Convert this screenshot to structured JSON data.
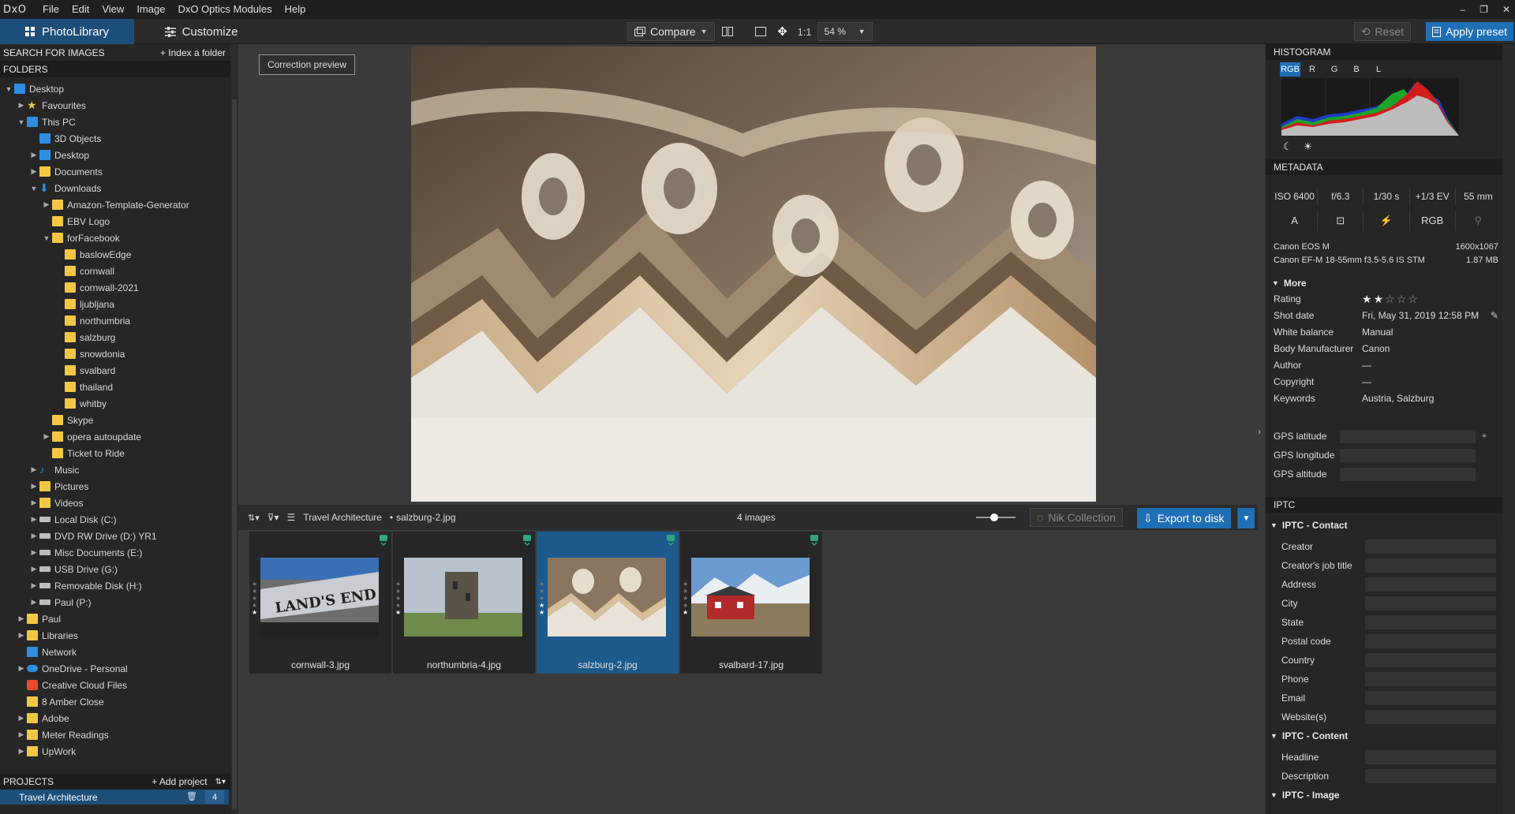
{
  "app": {
    "logo": "DxO"
  },
  "menu": [
    "File",
    "Edit",
    "View",
    "Image",
    "DxO Optics Modules",
    "Help"
  ],
  "window_controls": [
    "–",
    "❐",
    "✕"
  ],
  "toolbar": {
    "photolibrary_label": "PhotoLibrary",
    "customize_label": "Customize",
    "compare_label": "Compare",
    "ratio_label": "1:1",
    "zoom_value": "54 %",
    "reset_label": "Reset",
    "apply_preset_label": "Apply preset"
  },
  "left": {
    "search_label": "SEARCH FOR IMAGES",
    "index_label": "+ Index a folder",
    "folders_label": "FOLDERS",
    "tree": [
      {
        "label": "Desktop",
        "depth": 0,
        "arrow": "▼",
        "icon": "blue"
      },
      {
        "label": "Favourites",
        "depth": 1,
        "arrow": "▶",
        "icon": "star"
      },
      {
        "label": "This PC",
        "depth": 1,
        "arrow": "▼",
        "icon": "blue"
      },
      {
        "label": "3D Objects",
        "depth": 2,
        "arrow": "",
        "icon": "blue"
      },
      {
        "label": "Desktop",
        "depth": 2,
        "arrow": "▶",
        "icon": "blue"
      },
      {
        "label": "Documents",
        "depth": 2,
        "arrow": "▶",
        "icon": "folder"
      },
      {
        "label": "Downloads",
        "depth": 2,
        "arrow": "▼",
        "icon": "down"
      },
      {
        "label": "Amazon-Template-Generator",
        "depth": 3,
        "arrow": "▶",
        "icon": "folder"
      },
      {
        "label": "EBV Logo",
        "depth": 3,
        "arrow": "",
        "icon": "folder"
      },
      {
        "label": "forFacebook",
        "depth": 3,
        "arrow": "▼",
        "icon": "folder"
      },
      {
        "label": "baslowEdge",
        "depth": 4,
        "arrow": "",
        "icon": "folder"
      },
      {
        "label": "cornwall",
        "depth": 4,
        "arrow": "",
        "icon": "folder"
      },
      {
        "label": "cornwall-2021",
        "depth": 4,
        "arrow": "",
        "icon": "folder"
      },
      {
        "label": "ljubljana",
        "depth": 4,
        "arrow": "",
        "icon": "folder"
      },
      {
        "label": "northumbria",
        "depth": 4,
        "arrow": "",
        "icon": "folder"
      },
      {
        "label": "salzburg",
        "depth": 4,
        "arrow": "",
        "icon": "folder"
      },
      {
        "label": "snowdonia",
        "depth": 4,
        "arrow": "",
        "icon": "folder"
      },
      {
        "label": "svalbard",
        "depth": 4,
        "arrow": "",
        "icon": "folder"
      },
      {
        "label": "thailand",
        "depth": 4,
        "arrow": "",
        "icon": "folder"
      },
      {
        "label": "whitby",
        "depth": 4,
        "arrow": "",
        "icon": "folder"
      },
      {
        "label": "Skype",
        "depth": 3,
        "arrow": "",
        "icon": "folder"
      },
      {
        "label": "opera autoupdate",
        "depth": 3,
        "arrow": "▶",
        "icon": "folder"
      },
      {
        "label": "Ticket to Ride",
        "depth": 3,
        "arrow": "",
        "icon": "folder"
      },
      {
        "label": "Music",
        "depth": 2,
        "arrow": "▶",
        "icon": "music"
      },
      {
        "label": "Pictures",
        "depth": 2,
        "arrow": "▶",
        "icon": "folder"
      },
      {
        "label": "Videos",
        "depth": 2,
        "arrow": "▶",
        "icon": "folder"
      },
      {
        "label": "Local Disk (C:)",
        "depth": 2,
        "arrow": "▶",
        "icon": "drive"
      },
      {
        "label": "DVD RW Drive (D:) YR1",
        "depth": 2,
        "arrow": "▶",
        "icon": "drive"
      },
      {
        "label": "Misc Documents (E:)",
        "depth": 2,
        "arrow": "▶",
        "icon": "drive"
      },
      {
        "label": "USB Drive (G:)",
        "depth": 2,
        "arrow": "▶",
        "icon": "drive"
      },
      {
        "label": "Removable Disk (H:)",
        "depth": 2,
        "arrow": "▶",
        "icon": "drive"
      },
      {
        "label": "Paul (P:)",
        "depth": 2,
        "arrow": "▶",
        "icon": "drive"
      },
      {
        "label": "Paul",
        "depth": 1,
        "arrow": "▶",
        "icon": "folder"
      },
      {
        "label": "Libraries",
        "depth": 1,
        "arrow": "▶",
        "icon": "folder"
      },
      {
        "label": "Network",
        "depth": 1,
        "arrow": "",
        "icon": "blue"
      },
      {
        "label": "OneDrive - Personal",
        "depth": 1,
        "arrow": "▶",
        "icon": "cloud"
      },
      {
        "label": "Creative Cloud Files",
        "depth": 1,
        "arrow": "",
        "icon": "cc"
      },
      {
        "label": "8 Amber Close",
        "depth": 1,
        "arrow": "",
        "icon": "folder"
      },
      {
        "label": "Adobe",
        "depth": 1,
        "arrow": "▶",
        "icon": "folder"
      },
      {
        "label": "Meter Readings",
        "depth": 1,
        "arrow": "▶",
        "icon": "folder"
      },
      {
        "label": "UpWork",
        "depth": 1,
        "arrow": "▶",
        "icon": "folder"
      }
    ],
    "projects_label": "PROJECTS",
    "add_project_label": "+ Add project",
    "project_name": "Travel Architecture",
    "project_count": "4"
  },
  "viewer": {
    "correction_preview_label": "Correction preview"
  },
  "filmbar": {
    "project": "Travel Architecture",
    "separator": "•",
    "file": "salzburg-2.jpg",
    "count_label": "4 images",
    "nik_label": "Nik Collection",
    "export_label": "Export to disk"
  },
  "thumbnails": [
    {
      "filename": "cornwall-3.jpg",
      "selected": false
    },
    {
      "filename": "northumbria-4.jpg",
      "selected": false
    },
    {
      "filename": "salzburg-2.jpg",
      "selected": true
    },
    {
      "filename": "svalbard-17.jpg",
      "selected": false
    }
  ],
  "thumb_text": {
    "lands_end": "LAND'S END"
  },
  "right": {
    "histogram_label": "HISTOGRAM",
    "histogram_tabs": [
      "RGB",
      "R",
      "G",
      "B",
      "L"
    ],
    "metadata_label": "METADATA",
    "exif": [
      "ISO 6400",
      "f/6.3",
      "1/30 s",
      "+1/3 EV",
      "55 mm"
    ],
    "exif_icons": [
      "A",
      "⊡",
      "⚡",
      "RGB",
      "⚲"
    ],
    "camera": "Canon EOS M",
    "dimensions": "1600x1067",
    "lens": "Canon EF-M 18-55mm f3.5-5.6 IS STM",
    "filesize": "1.87 MB",
    "more_label": "More",
    "rating": 2,
    "fields": [
      {
        "k": "Rating",
        "v": ""
      },
      {
        "k": "Shot date",
        "v": "Fri, May 31, 2019 12:58 PM"
      },
      {
        "k": "White balance",
        "v": "Manual"
      },
      {
        "k": "Body Manufacturer",
        "v": "Canon"
      },
      {
        "k": "Author",
        "v": "—"
      },
      {
        "k": "Copyright",
        "v": "—"
      },
      {
        "k": "Keywords",
        "v": "Austria, Salzburg"
      }
    ],
    "gps": [
      "GPS latitude",
      "GPS longitude",
      "GPS altitude"
    ],
    "iptc_label": "IPTC",
    "iptc_contact_label": "IPTC - Contact",
    "iptc_contact": [
      "Creator",
      "Creator's job title",
      "Address",
      "City",
      "State",
      "Postal code",
      "Country",
      "Phone",
      "Email",
      "Website(s)"
    ],
    "iptc_content_label": "IPTC - Content",
    "iptc_content": [
      "Headline",
      "Description"
    ],
    "iptc_image_label": "IPTC - Image"
  }
}
